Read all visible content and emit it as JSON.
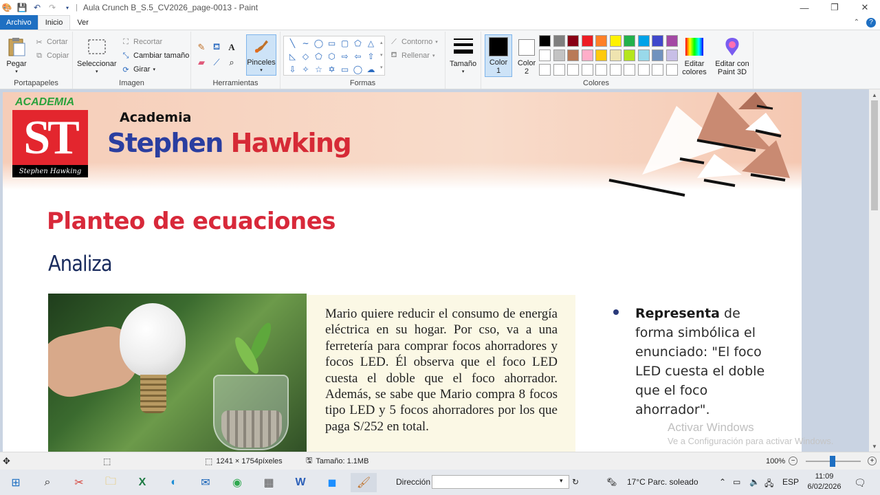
{
  "titlebar": {
    "title": "Aula Crunch B_S.5_CV2026_page-0013 - Paint",
    "minimize": "—",
    "restore": "❐",
    "close": "✕"
  },
  "tabs": {
    "file": "Archivo",
    "home": "Inicio",
    "view": "Ver"
  },
  "ribbon": {
    "clipboard": {
      "label": "Portapapeles",
      "paste": "Pegar",
      "cut": "Cortar",
      "copy": "Copiar"
    },
    "image": {
      "label": "Imagen",
      "select": "Seleccionar",
      "crop": "Recortar",
      "resize": "Cambiar tamaño",
      "rotate": "Girar"
    },
    "tools": {
      "label": "Herramientas",
      "brushes": "Pinceles"
    },
    "shapes": {
      "label": "Formas",
      "outline": "Contorno",
      "fill": "Rellenar"
    },
    "size": {
      "label": "Tamaño"
    },
    "colors": {
      "label": "Colores",
      "color1": "Color 1",
      "color2": "Color 2",
      "edit_colors": "Editar colores",
      "edit_paint3d": "Editar con Paint 3D",
      "row1": [
        "#000000",
        "#7f7f7f",
        "#880015",
        "#ed1c24",
        "#ff7f27",
        "#fff200",
        "#22b14c",
        "#00a2e8",
        "#3f48cc",
        "#a349a4"
      ],
      "row2": [
        "#ffffff",
        "#c3c3c3",
        "#b97a57",
        "#ffaec9",
        "#ffc90e",
        "#efe4b0",
        "#b5e61d",
        "#99d9ea",
        "#7092be",
        "#c8bfe7"
      ],
      "row3": [
        "#ffffff",
        "#ffffff",
        "#ffffff",
        "#ffffff",
        "#ffffff",
        "#ffffff",
        "#ffffff",
        "#ffffff",
        "#ffffff",
        "#ffffff"
      ]
    }
  },
  "document": {
    "logo_top": "ACADEMIA",
    "logo_letters": "ST",
    "logo_signature": "Stephen Hawking",
    "brand_small": "Academia",
    "brand_first": "Stephen",
    "brand_second": "Hawking",
    "heading": "Planteo de ecuaciones",
    "subheading": "Analiza",
    "problem_text": "Mario quiere reducir el consumo de energía eléctrica en su hogar. Por cso, va a una ferretería para comprar focos ahorradores y focos LED. Él observa que el foco LED cuesta el doble que el foco ahorrador. Además, se sabe que Mario compra 8 focos tipo LED y 5 focos ahorradores por los que paga S/252 en total.",
    "rep_bold": "Representa",
    "rep_rest": " de forma simbólica el enunciado: \"El foco LED cuesta el doble que el foco ahorrador\".",
    "watermark_title": "Activar Windows",
    "watermark_sub": "Ve a Configuración para activar Windows."
  },
  "statusbar": {
    "dimensions": "1241 × 1754píxeles",
    "size": "Tamaño: 1.1MB",
    "zoom": "100%"
  },
  "taskbar": {
    "address_label": "Dirección",
    "weather": "17°C  Parc. soleado",
    "lang": "ESP",
    "time": "11:09",
    "date": "6/02/2026"
  }
}
